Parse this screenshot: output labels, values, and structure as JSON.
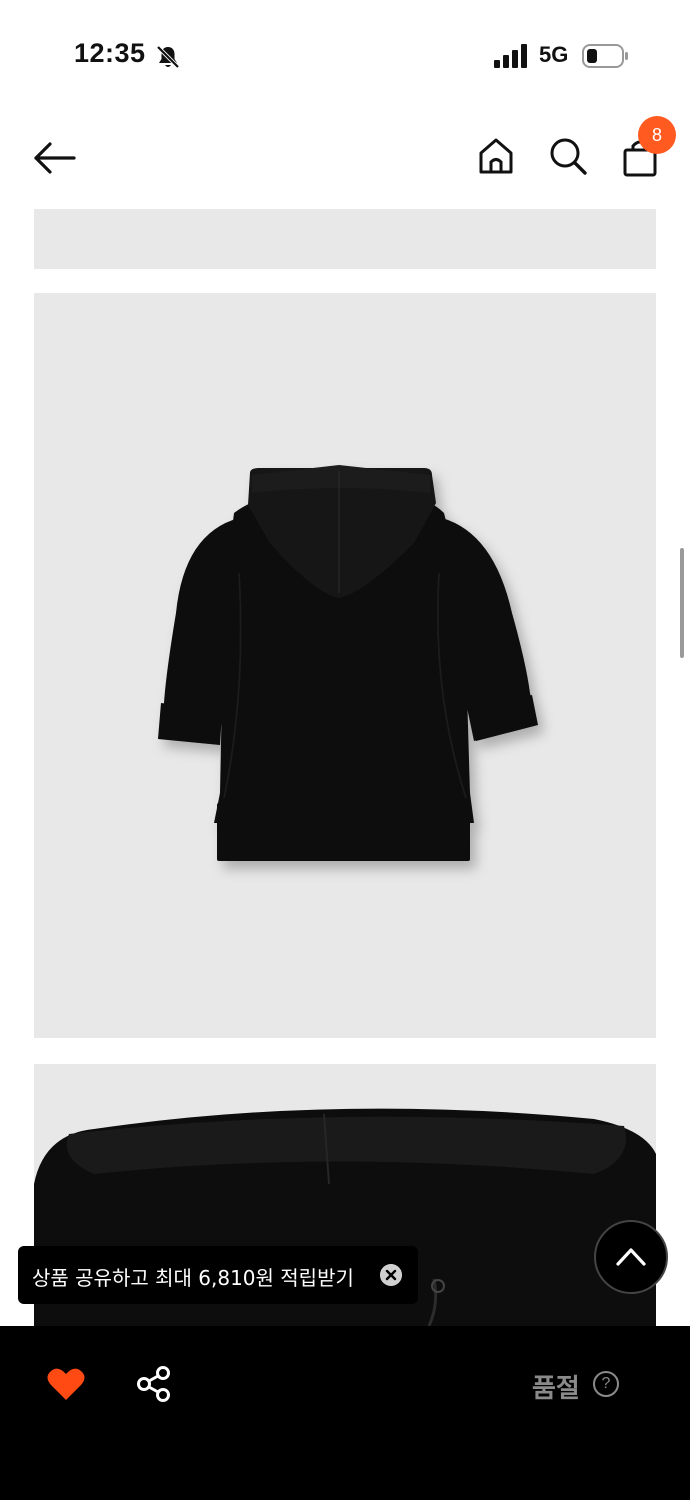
{
  "status_bar": {
    "time": "12:35",
    "network": "5G",
    "icons": [
      "bell-off-icon",
      "signal-icon",
      "battery-icon"
    ]
  },
  "header": {
    "back_icon": "arrow-left-icon",
    "home_icon": "home-icon",
    "search_icon": "search-icon",
    "bag_icon": "shopping-bag-icon",
    "cart_count": "8"
  },
  "product_images": [
    {
      "name": "product-image-partial",
      "description_visible": false
    },
    {
      "name": "product-image-hoodie-back",
      "description_visible": false
    },
    {
      "name": "product-image-hood-detail",
      "description_visible": false
    }
  ],
  "toast": {
    "message": "상품 공유하고 최대 6,810원 적립받기",
    "close_icon": "close-icon"
  },
  "bottom_bar": {
    "wish_icon": "heart-icon",
    "share_icon": "share-icon",
    "status_label": "품절",
    "help_label": "?"
  },
  "colors": {
    "accent": "#ff5a1f",
    "image_bg": "#e8e8e8",
    "bottom_bar_bg": "#000000",
    "soldout_text": "#8a8a8a"
  }
}
